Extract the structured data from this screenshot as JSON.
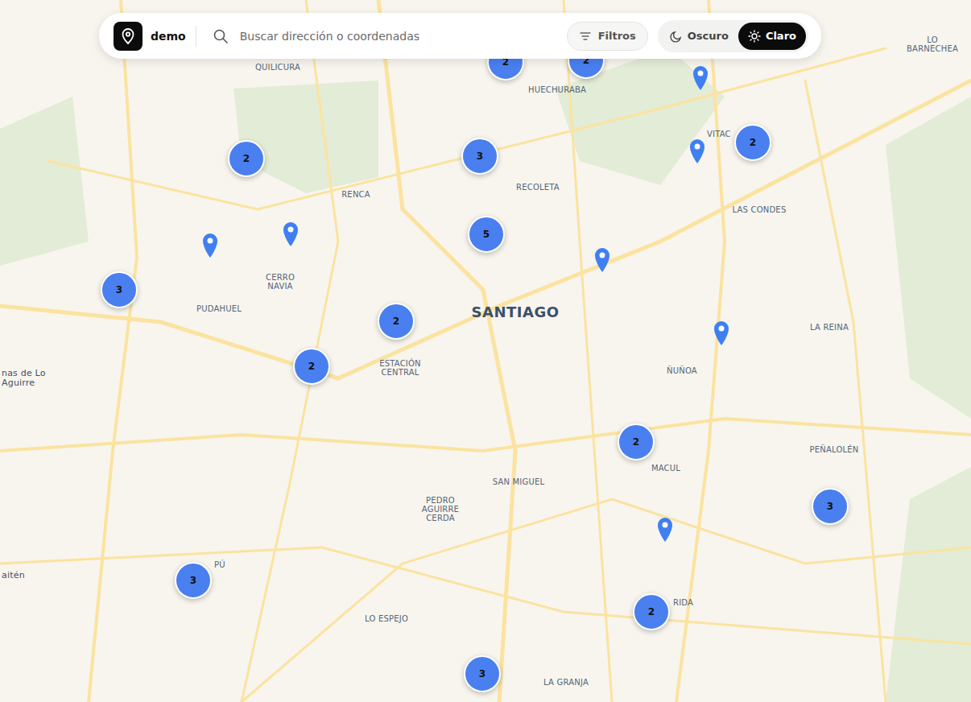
{
  "app": {
    "name": "demo"
  },
  "search": {
    "placeholder": "Buscar dirección o coordenadas"
  },
  "filters_button": {
    "label": "Filtros"
  },
  "theme_toggle": [
    {
      "label": "Oscuro",
      "selected": false
    },
    {
      "label": "Claro",
      "selected": true
    }
  ],
  "map_labels": [
    {
      "text": "QUILICURA",
      "kind": "district"
    },
    {
      "text": "HUECHURABA",
      "kind": "district"
    },
    {
      "text": "RECOLETA",
      "kind": "district"
    },
    {
      "text": "RENCA",
      "kind": "district"
    },
    {
      "text": "CERRO NAVIA",
      "kind": "district"
    },
    {
      "text": "PUDAHUEL",
      "kind": "district"
    },
    {
      "text": "SANTIAGO",
      "kind": "city"
    },
    {
      "text": "ESTACIÓN CENTRAL",
      "kind": "district"
    },
    {
      "text": "VITAC",
      "kind": "district"
    },
    {
      "text": "LAS CONDES",
      "kind": "district"
    },
    {
      "text": "LA REINA",
      "kind": "district"
    },
    {
      "text": "ÑUÑOA",
      "kind": "district"
    },
    {
      "text": "PEÑALOLÉN",
      "kind": "district"
    },
    {
      "text": "MACUL",
      "kind": "district"
    },
    {
      "text": "SAN MIGUEL",
      "kind": "district"
    },
    {
      "text": "PEDRO AGUIRRE CERDA",
      "kind": "district"
    },
    {
      "text": "LO ESPEJO",
      "kind": "district"
    },
    {
      "text": "LA GRANJA",
      "kind": "district"
    },
    {
      "text": "RIDA",
      "kind": "district"
    },
    {
      "text": "PÚ",
      "kind": "district"
    },
    {
      "text": "LO BARNECHEA",
      "kind": "district"
    },
    {
      "text": "nas de Lo Aguirre",
      "kind": "place"
    },
    {
      "text": "aitén",
      "kind": "place"
    }
  ],
  "markers": [
    {
      "kind": "cluster",
      "count": "2"
    },
    {
      "kind": "cluster",
      "count": "2"
    },
    {
      "kind": "cluster",
      "count": "2"
    },
    {
      "kind": "cluster",
      "count": "3"
    },
    {
      "kind": "cluster",
      "count": "5"
    },
    {
      "kind": "cluster",
      "count": "3"
    },
    {
      "kind": "cluster",
      "count": "2"
    },
    {
      "kind": "cluster",
      "count": "2"
    },
    {
      "kind": "cluster",
      "count": "2"
    },
    {
      "kind": "cluster",
      "count": "2"
    },
    {
      "kind": "cluster",
      "count": "3"
    },
    {
      "kind": "cluster",
      "count": "3"
    },
    {
      "kind": "cluster",
      "count": "2"
    },
    {
      "kind": "cluster",
      "count": "3"
    },
    {
      "kind": "pin",
      "count": ""
    },
    {
      "kind": "pin",
      "count": ""
    },
    {
      "kind": "pin",
      "count": ""
    },
    {
      "kind": "pin",
      "count": ""
    },
    {
      "kind": "pin",
      "count": ""
    },
    {
      "kind": "pin",
      "count": ""
    },
    {
      "kind": "pin",
      "count": ""
    }
  ]
}
